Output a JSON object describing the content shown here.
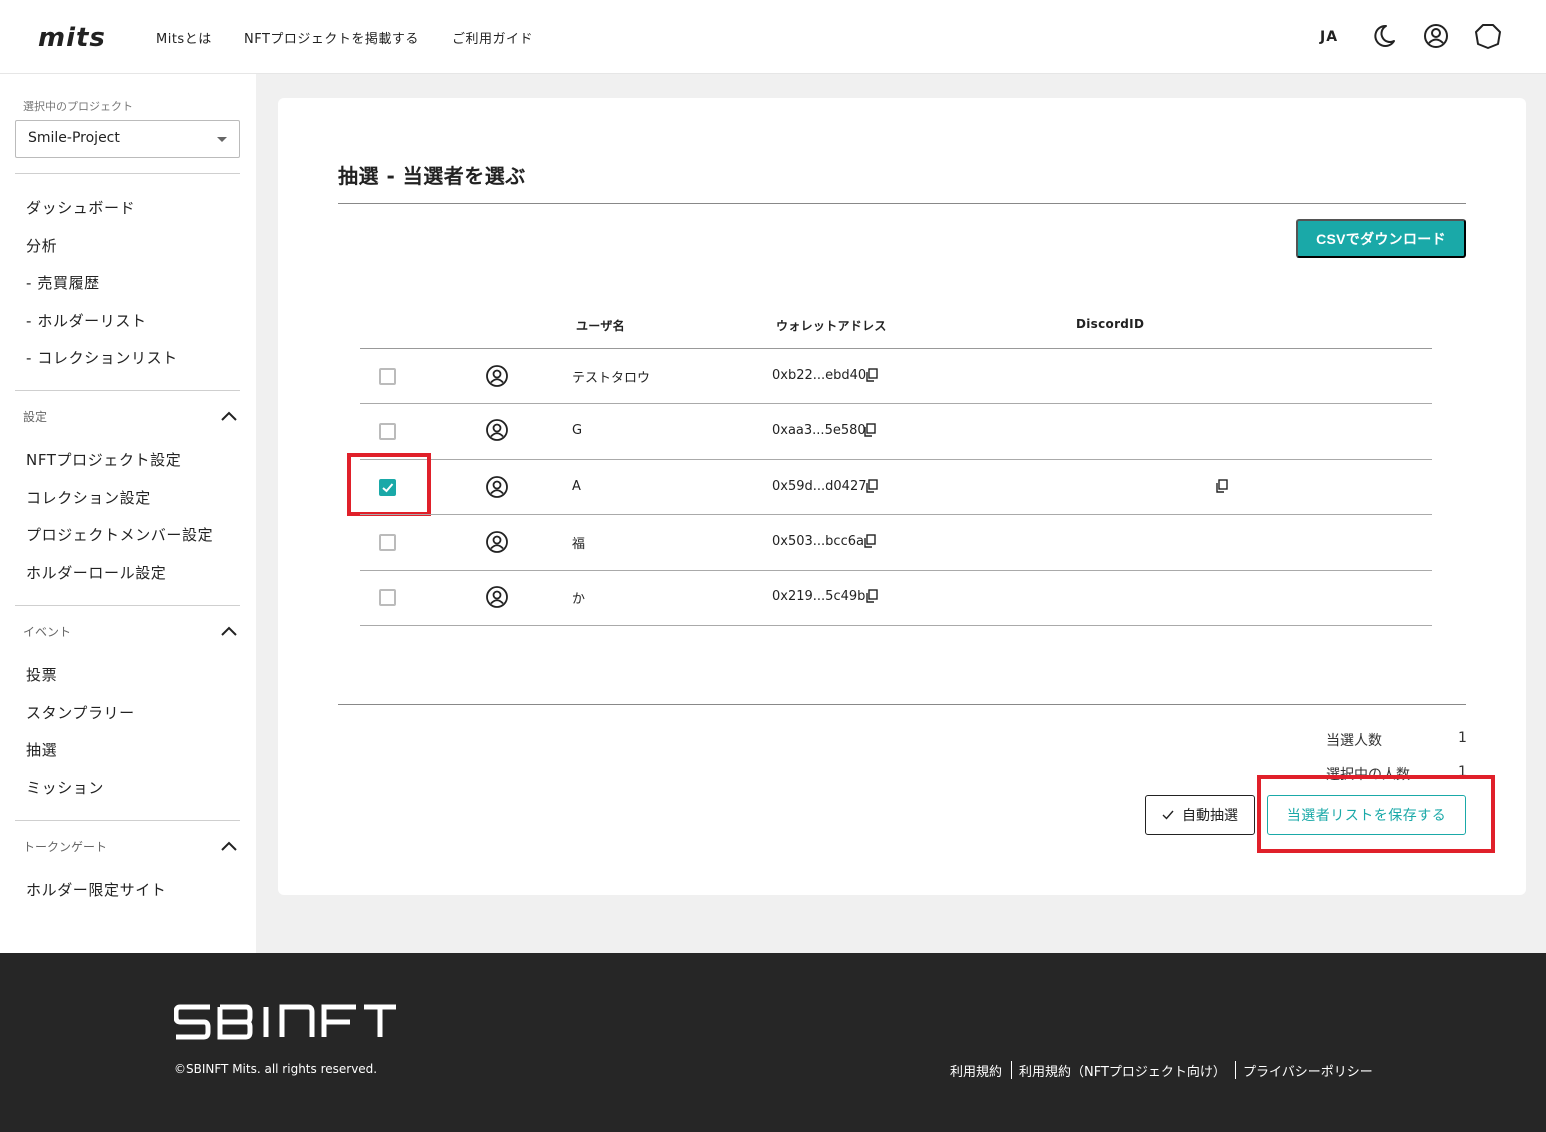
{
  "header": {
    "logo_text": "mits",
    "nav": [
      "Mitsとは",
      "NFTプロジェクトを掲載する",
      "ご利用ガイド"
    ],
    "lang": "JA",
    "icons": [
      "moon-icon",
      "account-icon",
      "wallet-icon"
    ]
  },
  "sidebar": {
    "project_caption": "選択中のプロジェクト",
    "project_selected": "Smile-Project",
    "main_items": [
      "ダッシュボード",
      "分析",
      "- 売買履歴",
      "- ホルダーリスト",
      "- コレクションリスト"
    ],
    "settings": {
      "title": "設定",
      "items": [
        "NFTプロジェクト設定",
        "コレクション設定",
        "プロジェクトメンバー設定",
        "ホルダーロール設定"
      ]
    },
    "events": {
      "title": "イベント",
      "items": [
        "投票",
        "スタンプラリー",
        "抽選",
        "ミッション"
      ]
    },
    "tokengate": {
      "title": "トークンゲート",
      "items": [
        "ホルダー限定サイト"
      ]
    }
  },
  "main": {
    "title": "抽選 - 当選者を選ぶ",
    "csv_button": "CSVでダウンロード",
    "columns": [
      "ユーザ名",
      "ウォレットアドレス",
      "DiscordID"
    ],
    "rows": [
      {
        "name": "テストタロウ",
        "address": "0xb22...ebd40",
        "checked": false,
        "discord_copy": false
      },
      {
        "name": "G",
        "address": "0xaa3...5e580",
        "checked": false,
        "discord_copy": false
      },
      {
        "name": "A",
        "address": "0x59d...d0427",
        "checked": true,
        "discord_copy": true
      },
      {
        "name": "福",
        "address": "0x503...bcc6a",
        "checked": false,
        "discord_copy": false
      },
      {
        "name": "か",
        "address": "0x219...5c49b",
        "checked": false,
        "discord_copy": false
      }
    ],
    "stats": [
      {
        "label": "当選人数",
        "value": "1"
      },
      {
        "label": "選択中の人数",
        "value": "1"
      }
    ],
    "auto_button": "自動抽選",
    "save_button": "当選者リストを保存する",
    "accent_color": "#1aa9a8",
    "highlight_color": "#e0202a"
  },
  "footer": {
    "brand": "SBINFT",
    "copyright": "©SBINFT Mits. all rights reserved.",
    "links": [
      "利用規約",
      "利用規約（NFTプロジェクト向け）",
      "プライバシーポリシー"
    ]
  }
}
